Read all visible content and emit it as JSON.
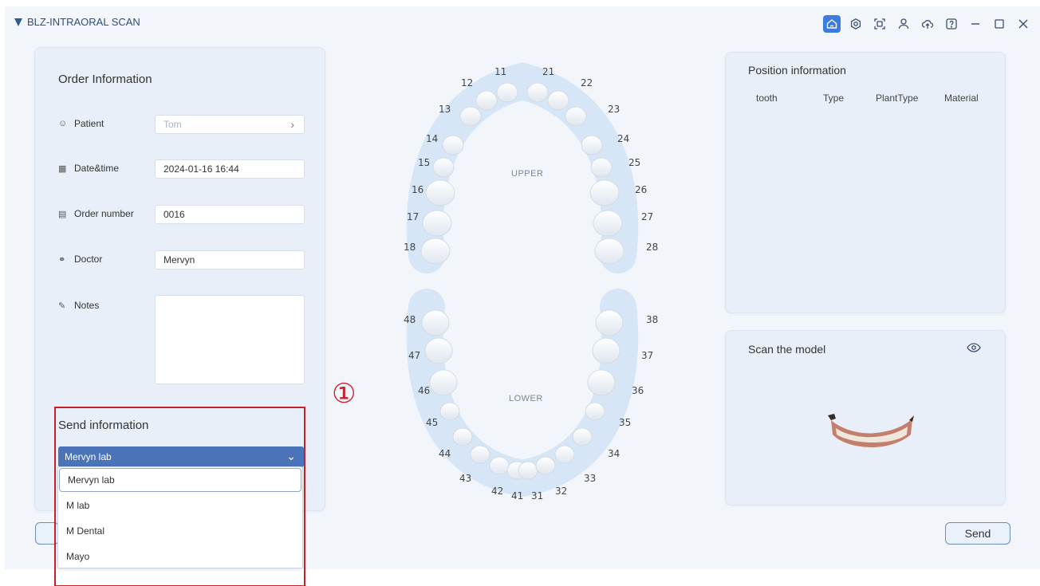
{
  "app": {
    "title": "BLZ-INTRAORAL SCAN"
  },
  "toolbar": {
    "icons": [
      "home-icon",
      "settings-icon",
      "scan-icon",
      "user-icon",
      "cloud-upload-icon",
      "help-icon",
      "minimize-icon",
      "maximize-icon",
      "close-icon"
    ],
    "accent": "#3e7be0"
  },
  "order": {
    "title": "Order Information",
    "patient_label": "Patient",
    "patient_value": "Tom",
    "datetime_label": "Date&time",
    "datetime_value": "2024-01-16 16:44",
    "order_number_label": "Order number",
    "order_number_value": "0016",
    "doctor_label": "Doctor",
    "doctor_value": "Mervyn",
    "notes_label": "Notes",
    "notes_value": ""
  },
  "send_info": {
    "title": "Send information",
    "selected": "Mervyn lab",
    "options": [
      "Mervyn lab",
      "M lab",
      "M Dental",
      "Mayo"
    ]
  },
  "annotation": {
    "number": "①",
    "color": "#c8202a"
  },
  "teeth": {
    "upper_label": "UPPER",
    "lower_label": "LOWER",
    "upper_numbers": [
      "18",
      "17",
      "16",
      "15",
      "14",
      "13",
      "12",
      "11",
      "21",
      "22",
      "23",
      "24",
      "25",
      "26",
      "27",
      "28"
    ],
    "lower_numbers": [
      "48",
      "47",
      "46",
      "45",
      "44",
      "43",
      "42",
      "41",
      "31",
      "32",
      "33",
      "34",
      "35",
      "36",
      "37",
      "38"
    ]
  },
  "position": {
    "title": "Position information",
    "columns": [
      "tooth",
      "Type",
      "PlantType",
      "Material"
    ]
  },
  "scan": {
    "title": "Scan the model"
  },
  "buttons": {
    "send": "Send"
  }
}
